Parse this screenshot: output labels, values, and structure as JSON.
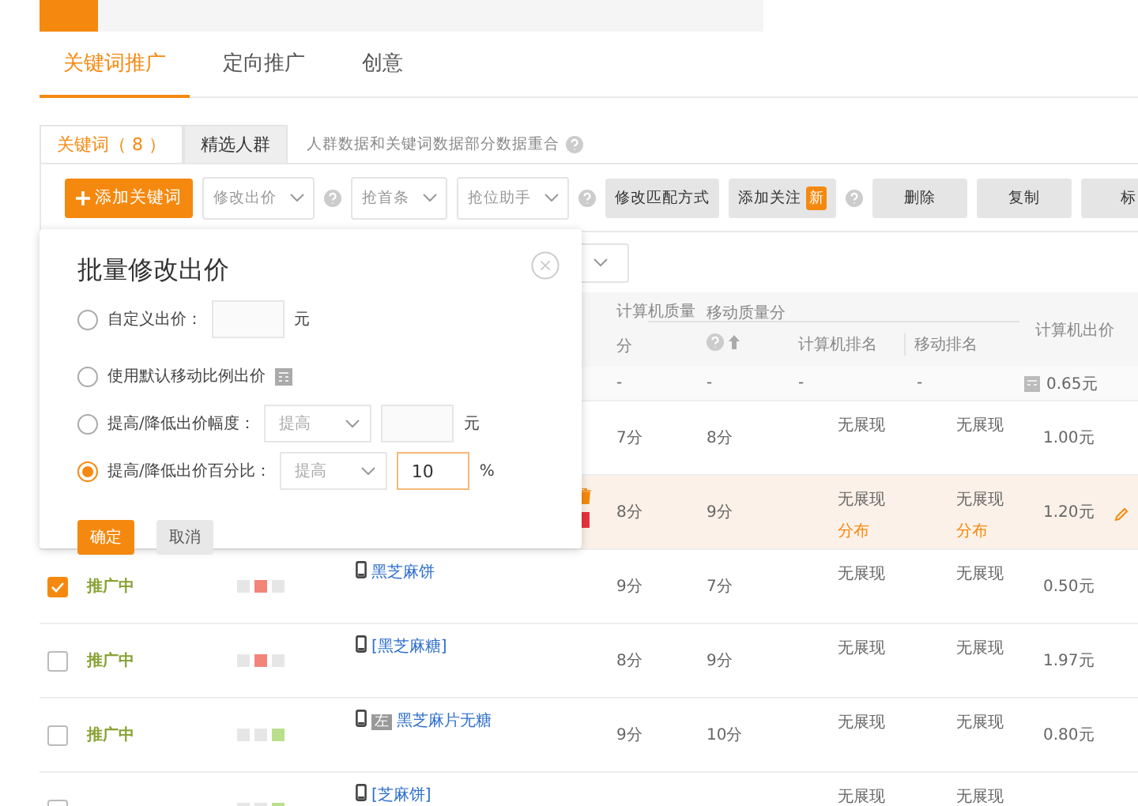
{
  "main_tabs": [
    {
      "label": "关键词推广",
      "selected": true
    },
    {
      "label": "定向推广",
      "selected": false
    },
    {
      "label": "创意",
      "selected": false
    }
  ],
  "sub_tabs": [
    {
      "label": "关键词（ 8 ）",
      "selected": true
    },
    {
      "label": "精选人群",
      "selected": false
    }
  ],
  "sub_note": "人群数据和关键词数据部分数据重合",
  "toolbar": [
    {
      "kind": "primary",
      "label": "添加关键词"
    },
    {
      "kind": "dropdown",
      "label": "修改出价"
    },
    {
      "kind": "help"
    },
    {
      "kind": "dropdown",
      "label": "抢首条"
    },
    {
      "kind": "dropdown",
      "label": "抢位助手"
    },
    {
      "kind": "help"
    },
    {
      "kind": "button",
      "label": "修改匹配方式"
    },
    {
      "kind": "button",
      "label": "添加关注",
      "badge": "新"
    },
    {
      "kind": "help"
    },
    {
      "kind": "button",
      "label": "删除"
    },
    {
      "kind": "button",
      "label": "复制"
    },
    {
      "kind": "button",
      "label": "标"
    }
  ],
  "popup": {
    "title": "批量修改出价",
    "options": [
      {
        "kind": "amount",
        "label": "自定义出价：",
        "unit": "元",
        "selected": false
      },
      {
        "kind": "default",
        "label": "使用默认移动比例出价",
        "selected": false
      },
      {
        "kind": "adjust",
        "label": "提高/降低出价幅度：",
        "select": "提高",
        "unit": "元",
        "selected": false
      },
      {
        "kind": "adjust",
        "label": "提高/降低出价百分比：",
        "select": "提高",
        "value": "10",
        "unit": "%",
        "selected": true
      }
    ],
    "confirm": "确定",
    "cancel": "取消"
  },
  "table": {
    "columns": [
      "计算机质量分",
      "移动质量分",
      "计算机排名",
      "移动排名",
      "计算机出价"
    ],
    "summary": {
      "cq": "-",
      "mq": "-",
      "cr": "-",
      "mr": "-",
      "bid": "0.65元"
    },
    "rows": [
      {
        "cq": "7分",
        "mq": "8分",
        "cr": "无展现",
        "mr": "无展现",
        "bid": "1.00元",
        "highlighted": false,
        "editable": false
      },
      {
        "cq": "8分",
        "mq": "9分",
        "cr": "无展现",
        "cr_link": "分布",
        "mr": "无展现",
        "mr_link": "分布",
        "bid": "1.20元",
        "highlighted": true,
        "editable": true
      },
      {
        "checked": true,
        "status": "推广中",
        "bars": [
          {
            "color": "#e6e6e6"
          },
          {
            "color": "#f2847a"
          },
          {
            "color": "#e6e6e6"
          }
        ],
        "keyword": "黑芝麻饼",
        "cq": "9分",
        "mq": "7分",
        "cr": "无展现",
        "mr": "无展现",
        "bid": "0.50元",
        "highlighted": false,
        "editable": false
      },
      {
        "checked": false,
        "status": "推广中",
        "bars": [
          {
            "color": "#e6e6e6"
          },
          {
            "color": "#f2847a"
          },
          {
            "color": "#e6e6e6"
          }
        ],
        "keyword": "[黑芝麻糖]",
        "cq": "8分",
        "mq": "9分",
        "cr": "无展现",
        "mr": "无展现",
        "bid": "1.97元",
        "highlighted": false,
        "editable": false
      },
      {
        "checked": false,
        "status": "推广中",
        "bars": [
          {
            "color": "#e6e6e6"
          },
          {
            "color": "#e6e6e6"
          },
          {
            "color": "#b9df8c"
          }
        ],
        "tag": "左",
        "keyword": "黑芝麻片无糖",
        "cq": "9分",
        "mq": "10分",
        "cr": "无展现",
        "mr": "无展现",
        "bid": "0.80元",
        "highlighted": false,
        "editable": false
      },
      {
        "checked": false,
        "bars": [
          {
            "color": "#e6e6e6"
          },
          {
            "color": "#e6e6e6"
          },
          {
            "color": "#b9df8c"
          }
        ],
        "keyword": "[芝麻饼]",
        "cr": "无展现",
        "mr": "无展现",
        "highlighted": false,
        "editable": false
      }
    ]
  }
}
